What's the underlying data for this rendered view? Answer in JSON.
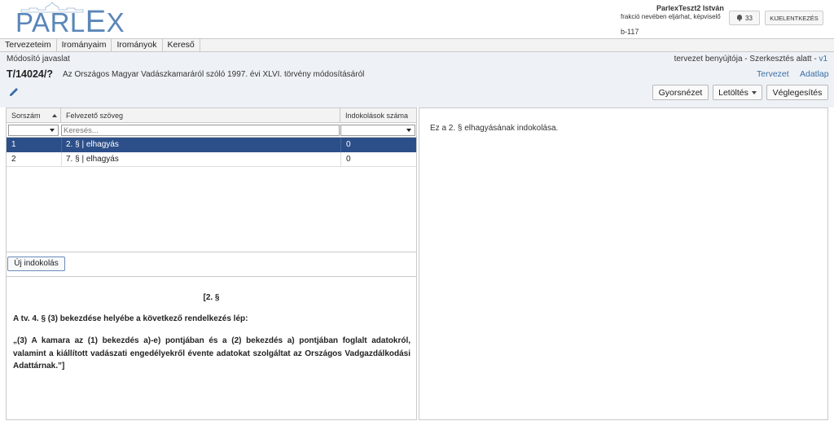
{
  "header": {
    "logo_text_a": "PARL",
    "logo_text_b": "E",
    "logo_text_c": "X",
    "user_name": "ParlexTeszt2 István",
    "user_role": "frakció nevében eljárhat, képviselő",
    "room": "b-117",
    "notification_count": "33",
    "logout_label": "KIJELENTKEZÉS"
  },
  "menu": {
    "items": [
      "Tervezeteim",
      "Irományaim",
      "Irományok",
      "Kereső"
    ]
  },
  "subheader": {
    "doc_type": "Módosító javaslat",
    "status_text": "tervezet benyújtója - Szerkesztés alatt - ",
    "version": "v1",
    "doc_id": "T/14024/?",
    "doc_title": "Az Országos Magyar Vadászkamaráról szóló 1997. évi XLVI. törvény módosításáról",
    "link_tervezet": "Tervezet",
    "link_adatlap": "Adatlap",
    "btn_gyors": "Gyorsnézet",
    "btn_letoltes": "Letöltés",
    "btn_vegleg": "Véglegesítés"
  },
  "grid": {
    "columns": [
      "Sorszám",
      "Felvezető szöveg",
      "Indokolások száma"
    ],
    "search_placeholder": "Keresés...",
    "rows": [
      {
        "num": "1",
        "text": "2. § | elhagyás",
        "count": "0",
        "selected": true
      },
      {
        "num": "2",
        "text": "7. § | elhagyás",
        "count": "0",
        "selected": false
      }
    ],
    "new_button": "Új indokolás"
  },
  "document": {
    "section": "[2. §",
    "intro": "A tv. 4. § (3) bekezdése helyébe a következő rendelkezés lép:",
    "body": "„(3) A kamara az (1) bekezdés a)-e) pontjában és a (2) bekezdés a) pontjában foglalt adatokról, valamint a kiállított vadászati engedélyekről évente adatokat szolgáltat az Országos Vadgazdálkodási Adattárnak.”]"
  },
  "right_panel": {
    "text": "Ez a 2. § elhagyásának indokolása."
  },
  "colors": {
    "logo": "#5a86b8",
    "selected_row": "#2c4f8a",
    "link": "#3a6ea5",
    "subheader_bg": "#eef2f6"
  }
}
